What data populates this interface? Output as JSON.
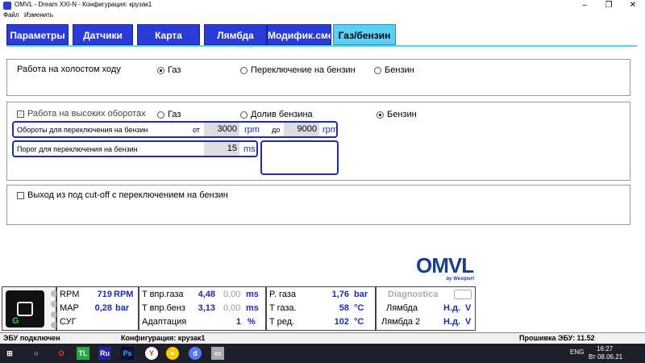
{
  "window": {
    "title": "OMVL - Dream XXI-N - Конфигурация: крузак1",
    "menu": [
      "Файл",
      "Изменить"
    ]
  },
  "tabs": [
    {
      "label": "Параметры",
      "active": false
    },
    {
      "label": "Датчики",
      "active": false
    },
    {
      "label": "Карта",
      "active": false
    },
    {
      "label": "Лямбда",
      "active": false
    },
    {
      "label": "Модифик.смес",
      "active": false
    },
    {
      "label": "Газ/бензин",
      "active": true
    }
  ],
  "idle": {
    "label": "Работа на холостом ходу",
    "options": [
      {
        "label": "Газ",
        "selected": true
      },
      {
        "label": "Переключение на бензин",
        "selected": false
      },
      {
        "label": "Бензин",
        "selected": false
      }
    ]
  },
  "high": {
    "label": "Работа на высоких оборотах",
    "options": [
      {
        "label": "Газ",
        "selected": false
      },
      {
        "label": "Долив бензина",
        "selected": false
      },
      {
        "label": "Бензин",
        "selected": true
      }
    ],
    "rpm_row": {
      "label": "Обороты для переключения на бензин",
      "from_label": "от",
      "from_value": "3000",
      "from_unit": "rpm",
      "to_label": "до",
      "to_value": "9000",
      "to_unit": "rpm"
    },
    "threshold_row": {
      "label": "Порог для переключения на бензин",
      "value": "15",
      "unit": "ms"
    }
  },
  "cutoff": {
    "label": "Выход из под cut-off с переключением на бензин",
    "checked": false
  },
  "logo": {
    "text": "OMVL",
    "sub": "by Westport",
    "brand_color": "#1c3f8c"
  },
  "dash": {
    "col1": [
      {
        "label": "RPM",
        "value": "719",
        "unit": "RPM"
      },
      {
        "label": "MAP",
        "value": "0,28",
        "unit": "bar"
      },
      {
        "label": "СУГ",
        "value": "",
        "unit": ""
      }
    ],
    "col2": [
      {
        "label": "T впр.газа",
        "value": "4,48",
        "extra": "0,00",
        "unit": "ms"
      },
      {
        "label": "T впр.бенз",
        "value": "3,13",
        "extra": "0,00",
        "unit": "ms"
      },
      {
        "label": "Адаптация",
        "value": "1",
        "extra": "",
        "unit": "%"
      }
    ],
    "col3": [
      {
        "label": "P. газа",
        "value": "1,76",
        "unit": "bar"
      },
      {
        "label": "T газа.",
        "value": "58",
        "unit": "°C"
      },
      {
        "label": "T ред.",
        "value": "102",
        "unit": "°C"
      }
    ],
    "col4": {
      "title": "Diagnostica",
      "rows": [
        {
          "label": "Лямбда",
          "value": "Н.д.",
          "unit": "V"
        },
        {
          "label": "Лямбда 2",
          "value": "Н.д.",
          "unit": "V"
        }
      ]
    }
  },
  "status": {
    "ecu": "ЭБУ подключен",
    "config": "Конфигурация: крузак1",
    "firmware": "Прошивка ЭБУ: 11.52"
  },
  "taskbar": {
    "lang": "ENG",
    "time": "16:27",
    "date": "Вт 08.06.21"
  }
}
